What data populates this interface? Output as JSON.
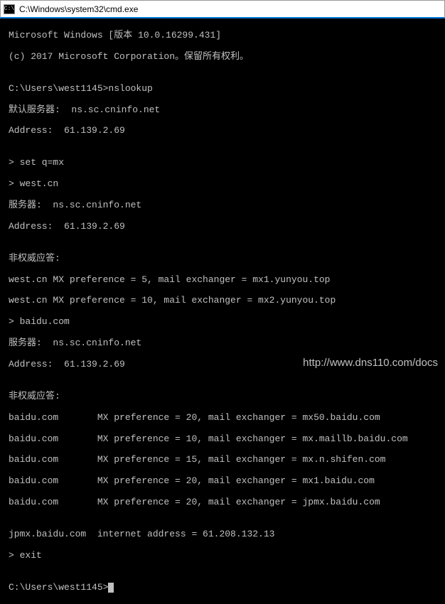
{
  "window": {
    "title": "C:\\Windows\\system32\\cmd.exe",
    "icon_name": "cmd-icon"
  },
  "terminal": {
    "lines": [
      "Microsoft Windows [版本 10.0.16299.431]",
      "(c) 2017 Microsoft Corporation。保留所有权利。",
      "",
      "C:\\Users\\west1145>nslookup",
      "默认服务器:  ns.sc.cninfo.net",
      "Address:  61.139.2.69",
      "",
      "> set q=mx",
      "> west.cn",
      "服务器:  ns.sc.cninfo.net",
      "Address:  61.139.2.69",
      "",
      "非权威应答:",
      "west.cn MX preference = 5, mail exchanger = mx1.yunyou.top",
      "west.cn MX preference = 10, mail exchanger = mx2.yunyou.top",
      "> baidu.com",
      "服务器:  ns.sc.cninfo.net",
      "Address:  61.139.2.69",
      "",
      "非权威应答:",
      "baidu.com       MX preference = 20, mail exchanger = mx50.baidu.com",
      "baidu.com       MX preference = 10, mail exchanger = mx.maillb.baidu.com",
      "baidu.com       MX preference = 15, mail exchanger = mx.n.shifen.com",
      "baidu.com       MX preference = 20, mail exchanger = mx1.baidu.com",
      "baidu.com       MX preference = 20, mail exchanger = jpmx.baidu.com",
      "",
      "jpmx.baidu.com  internet address = 61.208.132.13",
      "> exit",
      "",
      "C:\\Users\\west1145>"
    ]
  },
  "watermark": "http://www.dns110.com/docs"
}
